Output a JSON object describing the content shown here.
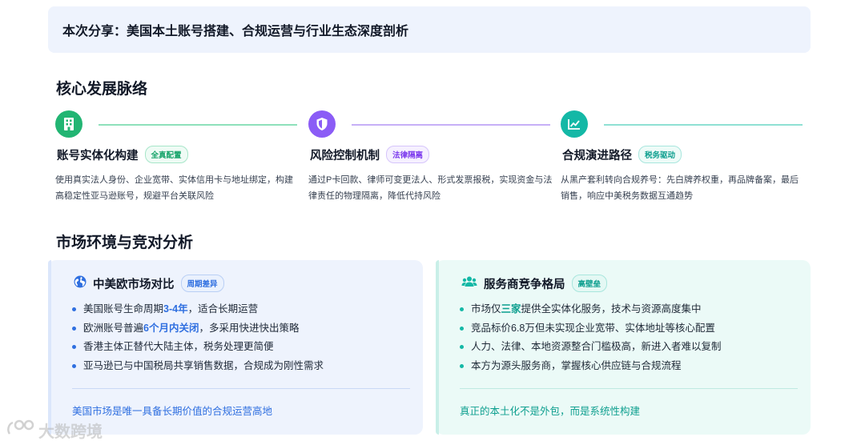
{
  "header": {
    "title": "本次分享：美国本土账号搭建、合规运营与行业生态深度剖析"
  },
  "section1": {
    "title": "核心发展脉络"
  },
  "steps": [
    {
      "icon": "building-icon",
      "color": "#22b573",
      "title": "账号实体化构建",
      "tag": "全真配置",
      "desc": "使用真实法人身份、企业宽带、实体信用卡与地址绑定，构建高稳定性亚马逊账号，规避平台关联风险"
    },
    {
      "icon": "shield-icon",
      "color": "#8b5cf6",
      "title": "风险控制机制",
      "tag": "法律隔离",
      "desc": "通过P卡回款、律师可变更法人、形式发票报税，实现资金与法律责任的物理隔离，降低代持风险"
    },
    {
      "icon": "trend-chart-icon",
      "color": "#14b8a6",
      "title": "合规演进路径",
      "tag": "税务驱动",
      "desc": "从黑产套利转向合规养号：先白牌养权重，再品牌备案，最后销售，响应中美税务数据互通趋势"
    }
  ],
  "section2": {
    "title": "市场环境与竞对分析"
  },
  "cards": [
    {
      "icon": "globe-icon",
      "title": "中美欧市场对比",
      "tag": "周期差异",
      "accent": "#2f6fe0",
      "items": [
        {
          "pre": "美国账号生命周期",
          "hl": "3-4年",
          "post": "，适合长期运营"
        },
        {
          "pre": "欧洲账号普遍",
          "hl": "6个月内关闭",
          "post": "，多采用快进快出策略"
        },
        {
          "pre": "香港主体正替代大陆主体，税务处理更简便",
          "hl": "",
          "post": ""
        },
        {
          "pre": "亚马逊已与中国税局共享销售数据，合规成为刚性需求",
          "hl": "",
          "post": ""
        }
      ],
      "footer": "美国市场是唯一具备长期价值的合规运营高地"
    },
    {
      "icon": "team-icon",
      "title": "服务商竞争格局",
      "tag": "高壁垒",
      "accent": "#14b8a6",
      "items": [
        {
          "pre": "市场仅",
          "hl": "三家",
          "post": "提供全实体化服务，技术与资源高度集中"
        },
        {
          "pre": "竞品标价6.8万但未实现企业宽带、实体地址等核心配置",
          "hl": "",
          "post": ""
        },
        {
          "pre": "人力、法律、本地资源整合门槛极高，新进入者难以复制",
          "hl": "",
          "post": ""
        },
        {
          "pre": "本方为源头服务商，掌握核心供应链与合规流程",
          "hl": "",
          "post": ""
        }
      ],
      "footer": "真正的本土化不是外包，而是系统性构建"
    }
  ],
  "watermark": {
    "text": "大数跨境"
  }
}
